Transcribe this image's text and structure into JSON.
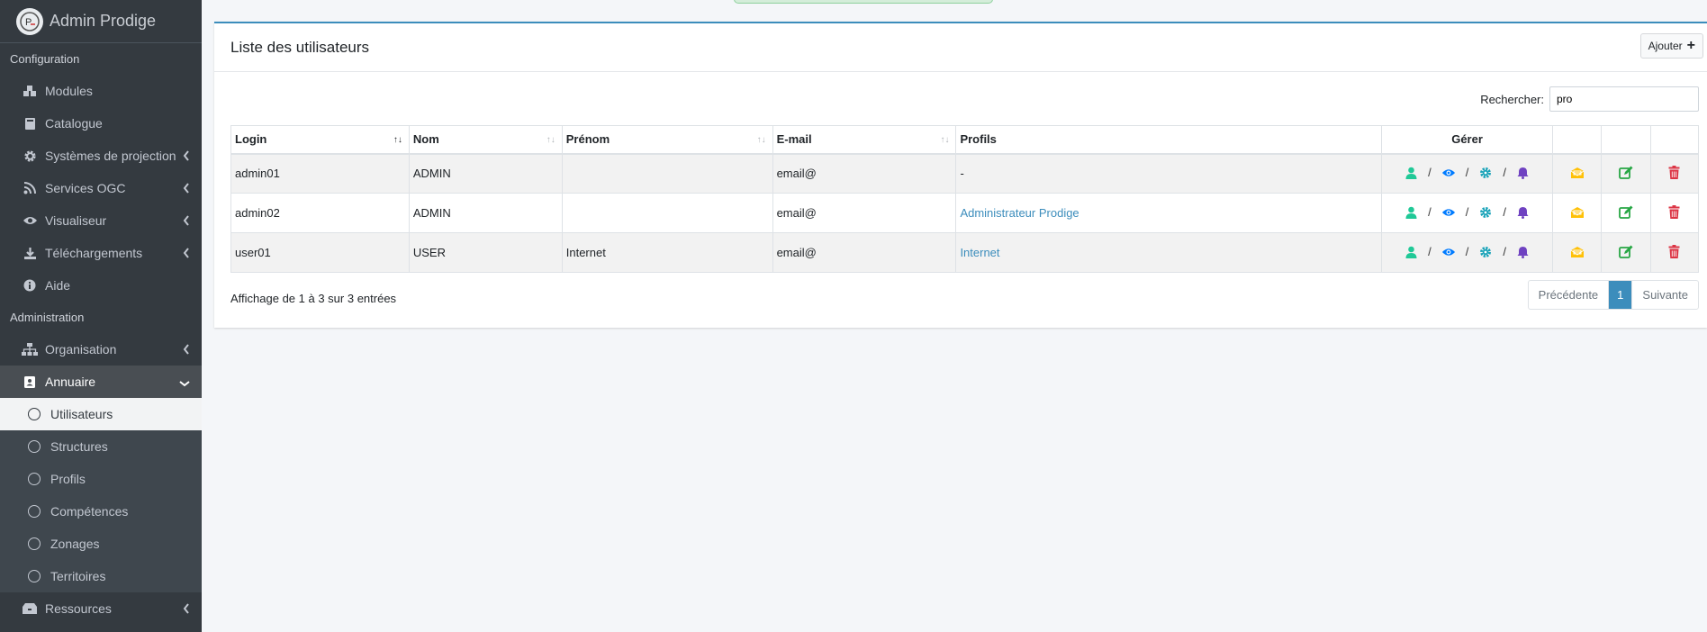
{
  "brand": {
    "title": "Admin Prodige"
  },
  "sidebar": {
    "section_config": "Configuration",
    "section_admin": "Administration",
    "config_items": [
      {
        "label": "Modules",
        "icon": "cubes-icon"
      },
      {
        "label": "Catalogue",
        "icon": "book-icon"
      },
      {
        "label": "Systèmes de projection",
        "icon": "gear-icon"
      },
      {
        "label": "Services OGC",
        "icon": "rss-icon"
      },
      {
        "label": "Visualiseur",
        "icon": "eye-icon"
      },
      {
        "label": "Téléchargements",
        "icon": "download-icon"
      },
      {
        "label": "Aide",
        "icon": "info-icon"
      }
    ],
    "admin_items": [
      {
        "label": "Organisation",
        "icon": "sitemap-icon"
      },
      {
        "label": "Annuaire",
        "icon": "address-book-icon"
      }
    ],
    "annuaire_sub": [
      {
        "label": "Utilisateurs"
      },
      {
        "label": "Structures"
      },
      {
        "label": "Profils"
      },
      {
        "label": "Compétences"
      },
      {
        "label": "Zonages"
      },
      {
        "label": "Territoires"
      }
    ],
    "ressources": {
      "label": "Ressources",
      "icon": "boxes-icon"
    }
  },
  "card": {
    "title": "Liste des utilisateurs",
    "add_label": "Ajouter"
  },
  "search": {
    "label": "Rechercher:",
    "value": "pro"
  },
  "table": {
    "headers": [
      "Login",
      "Nom",
      "Prénom",
      "E-mail",
      "Profils",
      "Gérer"
    ],
    "rows": [
      {
        "login": "admin01",
        "nom": "ADMIN",
        "prenom": "",
        "email": "email@",
        "profils": "-"
      },
      {
        "login": "admin02",
        "nom": "ADMIN",
        "prenom": "",
        "email": "email@",
        "profils": "Administrateur Prodige"
      },
      {
        "login": "user01",
        "nom": "USER",
        "prenom": "Internet",
        "email": "email@",
        "profils": "Internet"
      }
    ],
    "separator": "/"
  },
  "footer": {
    "info": "Affichage de 1 à 3 sur 3 entrées",
    "prev": "Précédente",
    "page": "1",
    "next": "Suivante"
  },
  "colors": {
    "sidebar_bg": "#343a40",
    "accent": "#3c8dbc",
    "user_icon": "#20c997",
    "eye_icon": "#007bff",
    "gear_icon": "#17a2b8",
    "bell_icon": "#6f42c1",
    "mail_icon": "#ffc107",
    "edit_icon": "#28a745",
    "delete_icon": "#dc3545"
  }
}
